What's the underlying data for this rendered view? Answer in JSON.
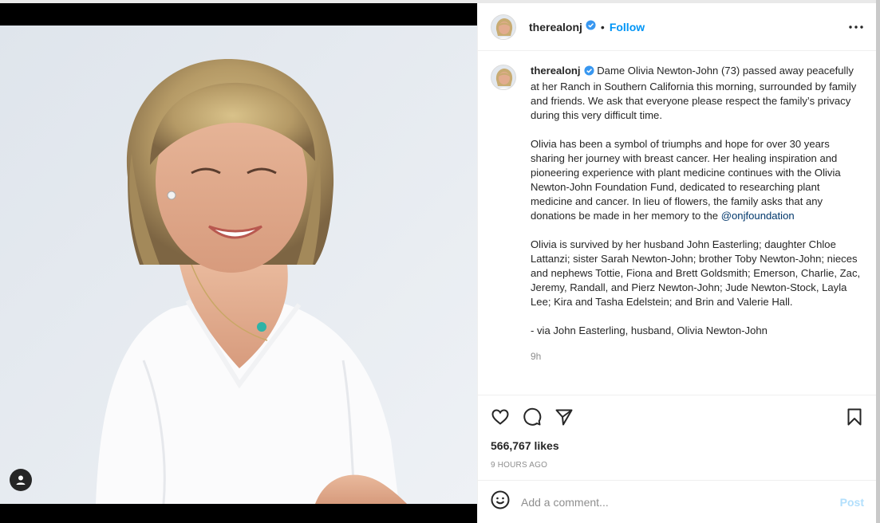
{
  "post": {
    "username": "therealonj",
    "follow_label": "Follow",
    "separator": "•",
    "caption_p1": "Dame Olivia Newton-John (73) passed away peacefully at her Ranch in Southern California this morning, surrounded by family and friends. We ask that everyone please respect the family’s privacy during this very difficult time.",
    "caption_p2": "Olivia has been a symbol of triumphs and hope for over 30 years sharing her journey with breast cancer. Her healing inspiration and pioneering experience with plant medicine continues with the Olivia Newton-John Foundation Fund, dedicated to researching plant medicine and cancer. In lieu of flowers, the family asks that any donations be made in her memory to the",
    "mention": "@onjfoundation",
    "caption_p3": "Olivia is survived by her husband John Easterling; daughter Chloe Lattanzi; sister Sarah Newton-John; brother Toby Newton-John; nieces and nephews Tottie, Fiona and Brett Goldsmith; Emerson, Charlie, Zac, Jeremy, Randall, and Pierz Newton-John; Jude Newton-Stock, Layla Lee; Kira and Tasha Edelstein; and Brin and Valerie Hall.",
    "caption_p4": "- via John Easterling, husband, Olivia Newton-John",
    "time_ago": "9h",
    "likes": "566,767 likes",
    "timestamp": "9 HOURS AGO"
  },
  "comment": {
    "placeholder": "Add a comment...",
    "post_label": "Post"
  },
  "icons": {
    "like": "heart-icon",
    "comment": "comment-icon",
    "share": "paper-plane-icon",
    "save": "bookmark-icon",
    "emoji": "smiley-icon",
    "more": "ellipsis-icon",
    "verified": "verified-badge-icon",
    "tags": "user-tag-icon"
  },
  "colors": {
    "follow": "#0095f6",
    "mention": "#00376b",
    "verified": "#3897f0",
    "post_disabled": "#b2dffc"
  }
}
